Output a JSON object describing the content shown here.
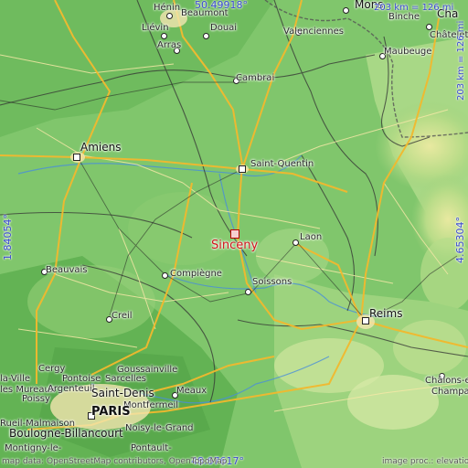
{
  "place": {
    "name": "Sinceny"
  },
  "coordinates": {
    "top": "50.49918°",
    "bottom": "48.67617°",
    "left": "1.84054°",
    "right": "4.65304°"
  },
  "scale": {
    "horizontal": "203 km = 126 mi",
    "vertical": "203 km = 126 mi"
  },
  "credits": {
    "left": "map data: OpenStreetMap contributors, OpenTopoMap",
    "right": "image proc.: elevation.city"
  },
  "cities": {
    "henin": "Hénin",
    "beaumont": "Beaumont",
    "lievin": "Liévin",
    "douai": "Douai",
    "arras": "Arras",
    "valenciennes": "Valenciennes",
    "mons": "Mons",
    "binche": "Binche",
    "charleroi": "Cha",
    "chatelet": "Châtelet",
    "maubeuge": "Maubeuge",
    "cambrai": "Cambrai",
    "amiens": "Amiens",
    "saint_quentin": "Saint-Quentin",
    "laon": "Laon",
    "beauvais": "Beauvais",
    "compiegne": "Compiègne",
    "soissons": "Soissons",
    "creil": "Creil",
    "reims": "Reims",
    "cergy": "Cergy",
    "pontoise": "Pontoise",
    "sarcelles": "Sarcelles",
    "goussainville": "Goussainville",
    "poissy": "Poissy",
    "argenteuil": "Argenteuil",
    "saint_denis": "Saint-Denis",
    "montfermeil": "Montfermeil",
    "meaux": "Meaux",
    "les_mureaux": "les Mureaux",
    "la_ville": "la-Ville",
    "rueil_malmaison": "Rueil-Malmaison",
    "paris": "PARIS",
    "boulogne": "Boulogne-Billancourt",
    "noisy": "Noisy-le-Grand",
    "montigny": "Montigny-le-",
    "pontault": "Pontault-",
    "chalons": "Châlons-en-",
    "champagne": "Champagne"
  }
}
